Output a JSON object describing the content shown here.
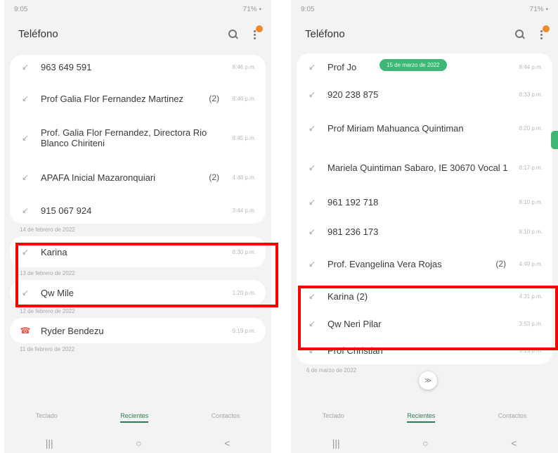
{
  "left": {
    "status": {
      "time": "9:05",
      "right": "71% ▪"
    },
    "header": {
      "title": "Teléfono"
    },
    "calls": [
      {
        "name": "963 649 591",
        "count": "",
        "time": "8:46 p.m."
      },
      {
        "name": "Prof Galia Flor Fernandez Martinez",
        "count": "(2)",
        "time": "8:46 p.m."
      },
      {
        "name": "Prof. Galia Flor Fernandez, Directora Rio Blanco Chiriteni",
        "count": "",
        "time": "8:45 p.m."
      },
      {
        "name": "APAFA Inicial Mazaronquiari",
        "count": "(2)",
        "time": "4:48 p.m."
      },
      {
        "name": "915 067 924",
        "count": "",
        "time": "3:44 p.m."
      }
    ],
    "date1": "14 de febrero de 2022",
    "call_karina": {
      "name": "Karina",
      "time": "8:30 p.m."
    },
    "date2": "13 de febrero de 2022",
    "call_qw": {
      "name": "Qw Mile",
      "time": "1:20 p.m."
    },
    "date3": "12 de febrero de 2022",
    "call_ryder": {
      "name": "Ryder Bendezu",
      "time": "9:19 p.m."
    },
    "date4": "11 de febrero de 2022",
    "tabs": [
      "Teclado",
      "Recientes",
      "Contactos"
    ],
    "nav": {
      "recent": "|||",
      "home": "○",
      "back": "<"
    }
  },
  "right": {
    "status": {
      "time": "9:05",
      "right": "71% ▪"
    },
    "header": {
      "title": "Teléfono"
    },
    "toast": "15 de marzo de 2022",
    "calls": [
      {
        "name": "Prof Jo",
        "count": "",
        "time": "8:44 p.m."
      },
      {
        "name": "920 238 875",
        "count": "",
        "time": "8:33 p.m."
      },
      {
        "name": "Prof Miriam Mahuanca Quintiman",
        "count": "",
        "time": "8:20 p.m."
      },
      {
        "name": "Mariela Quintiman Sabaro, IE 30670 Vocal 1",
        "count": "",
        "time": "8:17 p.m."
      },
      {
        "name": "961 192 718",
        "count": "",
        "time": "8:10 p.m."
      },
      {
        "name": "981 236 173",
        "count": "",
        "time": "8:10 p.m."
      },
      {
        "name": "Prof. Evangelina Vera Rojas",
        "count": "(2)",
        "time": "4:49 p.m."
      },
      {
        "name": "Karina (2)",
        "count": "",
        "time": "4:31 p.m."
      },
      {
        "name": "Qw Neri Pilar",
        "count": "",
        "time": "3:53 p.m."
      },
      {
        "name": "Prof Christian",
        "count": "",
        "time": "3:13 p.m."
      }
    ],
    "date": "6 de marzo de 2022",
    "fab": "≫",
    "tabs": [
      "Teclado",
      "Recientes",
      "Contactos"
    ],
    "nav": {
      "recent": "|||",
      "home": "○",
      "back": "<"
    }
  }
}
